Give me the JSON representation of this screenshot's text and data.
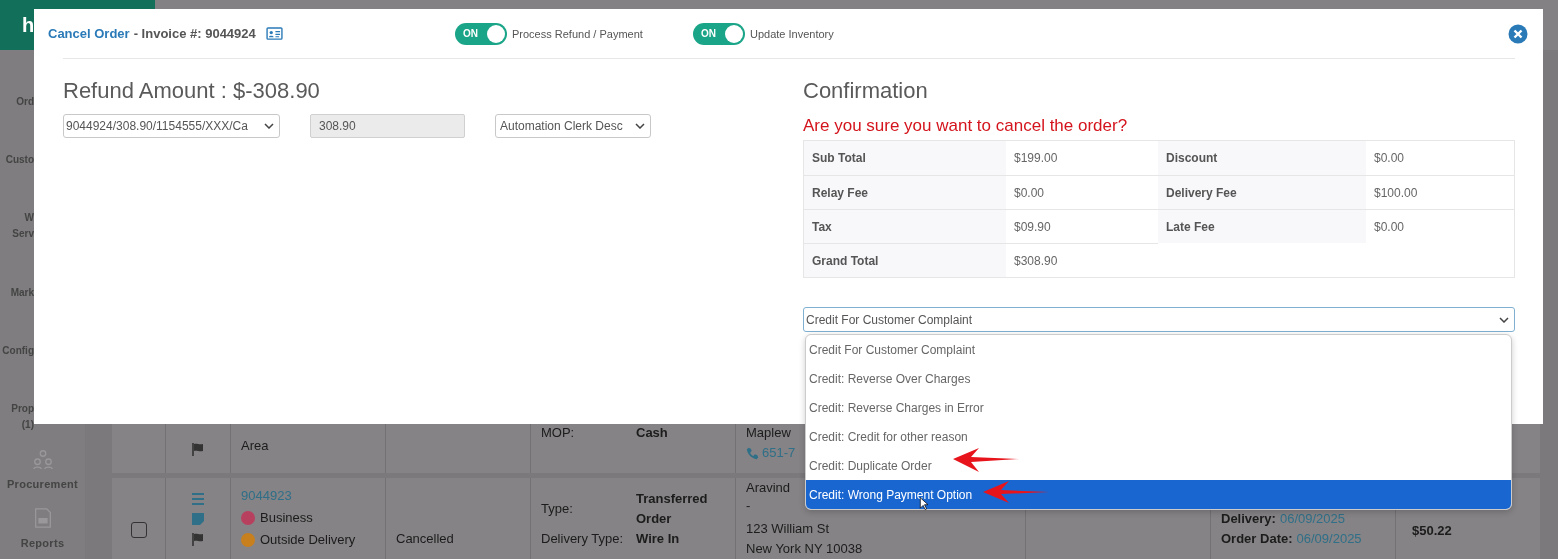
{
  "app_header": {
    "logo_text": "h"
  },
  "sidebar": {
    "items": [
      {
        "kind": "clipped",
        "lines": [
          "Ord"
        ]
      },
      {
        "kind": "clipped",
        "lines": [
          "Custo"
        ]
      },
      {
        "kind": "clipped",
        "lines": [
          "W",
          "Serv"
        ]
      },
      {
        "kind": "clipped",
        "lines": [
          "Mark"
        ]
      },
      {
        "kind": "clipped",
        "lines": [
          "Config"
        ]
      },
      {
        "kind": "clipped",
        "lines": [
          "Prop",
          "(1)"
        ]
      },
      {
        "kind": "people",
        "lines": [
          "Procurement"
        ]
      },
      {
        "kind": "document",
        "lines": [
          "Reports"
        ]
      }
    ]
  },
  "orders": [
    {
      "icons": [
        {
          "kind": "flag"
        }
      ],
      "order": {
        "details": [
          {
            "text": "Area"
          }
        ]
      },
      "fields": [
        {
          "label": "MOP:",
          "value": "Cash"
        }
      ],
      "customer": {
        "name": "Maplew",
        "phone": "651-7"
      }
    },
    {
      "checked": false,
      "icons": [
        {
          "kind": "list"
        },
        {
          "kind": "note"
        },
        {
          "kind": "flag"
        }
      ],
      "order": {
        "number": "9044923",
        "details": [
          {
            "text": "Business",
            "color": "#b8405f"
          },
          {
            "text": "Outside Delivery",
            "color": "#c8801e"
          }
        ]
      },
      "status": "Cancelled",
      "fields": [
        {
          "label": "Type:",
          "value": "Transferred Order"
        },
        {
          "label": "Delivery Type:",
          "value": "Wire In"
        }
      ],
      "customer": {
        "name": "Aravind",
        "lines": [
          "-",
          "123 William St",
          "New York NY 10038"
        ]
      },
      "dates": [
        {
          "label": "Delivery:",
          "value": "06/09/2025"
        },
        {
          "label": "Order Date:",
          "value": "06/09/2025"
        }
      ],
      "amount": "$50.22"
    }
  ],
  "modal": {
    "title_link": "Cancel Order",
    "title_rest": "- Invoice #: 9044924",
    "toggles": [
      {
        "state_text": "ON",
        "on": true,
        "label": "Process Refund / Payment"
      },
      {
        "state_text": "ON",
        "on": true,
        "label": "Update Inventory"
      }
    ],
    "refund_title": "Refund Amount : $-308.90",
    "payment_select": "9044924/308.90/1154555/XXX/Ca",
    "amount_field": "308.90",
    "clerk_select": "Automation Clerk Desc",
    "confirmation_title": "Confirmation",
    "warning": "Are you sure you want to cancel the order?",
    "totals": [
      {
        "label": "Sub Total",
        "value": "$199.00"
      },
      {
        "label": "Discount",
        "value": "$0.00"
      },
      {
        "label": "Relay Fee",
        "value": "$0.00"
      },
      {
        "label": "Delivery Fee",
        "value": "$100.00"
      },
      {
        "label": "Tax",
        "value": "$09.90"
      },
      {
        "label": "Late Fee",
        "value": "$0.00"
      },
      {
        "label": "Grand Total",
        "value": "$308.90"
      }
    ],
    "reason_select": {
      "value": "Credit For Customer Complaint",
      "options": [
        {
          "label": "Credit For Customer Complaint",
          "highlighted": false
        },
        {
          "label": "Credit: Reverse Over Charges",
          "highlighted": false
        },
        {
          "label": "Credit: Reverse Charges in Error",
          "highlighted": false
        },
        {
          "label": "Credit: Credit for other reason",
          "highlighted": false
        },
        {
          "label": "Credit: Duplicate Order",
          "highlighted": false
        },
        {
          "label": "Credit: Wrong Payment Option",
          "highlighted": true
        }
      ]
    }
  }
}
